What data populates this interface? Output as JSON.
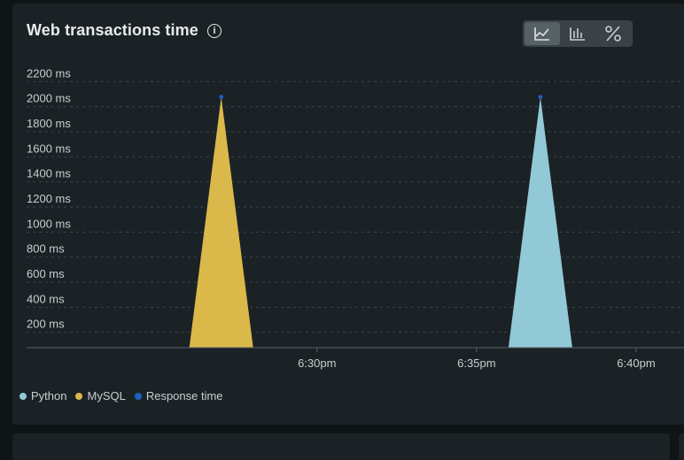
{
  "panel": {
    "title": "Web transactions time",
    "info_icon": "info-icon",
    "view_toggles": [
      {
        "name": "line-chart-icon",
        "glyph": "↗",
        "active": true
      },
      {
        "name": "bar-chart-icon",
        "glyph": "❙",
        "active": false
      },
      {
        "name": "percent-icon",
        "glyph": "%",
        "active": false
      }
    ]
  },
  "colors": {
    "python": "#92c9d6",
    "mysql": "#dbb84a",
    "response_time": "#1f5fc2"
  },
  "chart_data": {
    "type": "area",
    "title": "Web transactions time",
    "y_ticks": [
      "200 ms",
      "400 ms",
      "600 ms",
      "800 ms",
      "1000 ms",
      "1200 ms",
      "1400 ms",
      "1600 ms",
      "1800 ms",
      "2000 ms",
      "2200 ms"
    ],
    "x_ticks": [
      "6:30pm",
      "6:35pm",
      "6:40pm"
    ],
    "ylim": [
      0,
      2200
    ],
    "x_unit": "minutes after 6:25pm",
    "xlim": [
      -4.1,
      16.5
    ],
    "grid": true,
    "legend_position": "bottom-left",
    "series": [
      {
        "name": "Python",
        "color": "#92c9d6",
        "points": [
          [
            11,
            0
          ],
          [
            12,
            2000
          ],
          [
            13,
            0
          ]
        ]
      },
      {
        "name": "MySQL",
        "color": "#dbb84a",
        "points": [
          [
            1,
            0
          ],
          [
            2,
            2000
          ],
          [
            3,
            0
          ]
        ]
      },
      {
        "name": "Response time",
        "color": "#1f5fc2",
        "points": [
          [
            2,
            2000
          ],
          [
            12,
            2000
          ]
        ]
      }
    ]
  }
}
